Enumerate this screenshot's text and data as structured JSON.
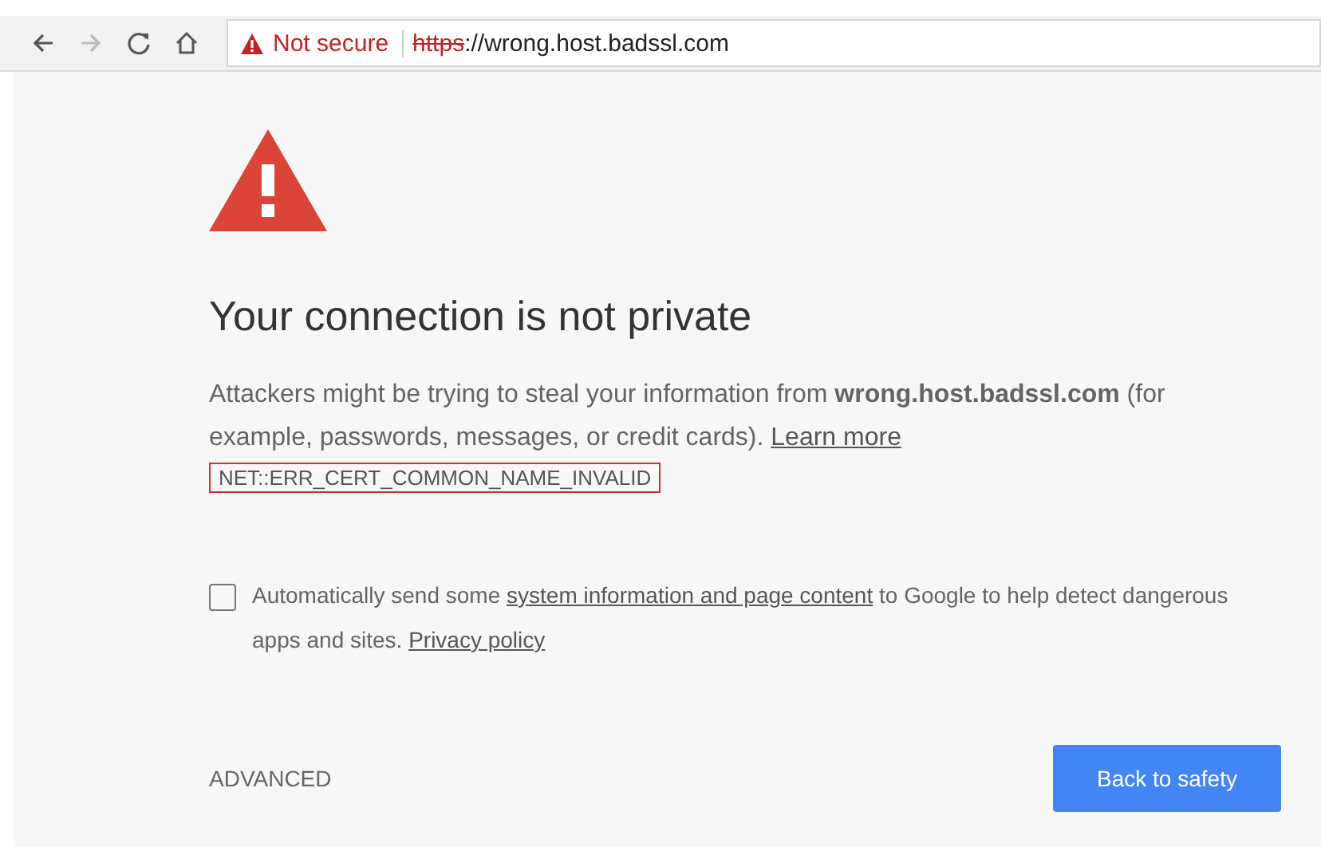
{
  "toolbar": {
    "security_label": "Not secure",
    "url_scheme": "https",
    "url_rest": "://wrong.host.badssl.com"
  },
  "page": {
    "title": "Your connection is not private",
    "message": "Attackers might be trying to steal your information from **wrong.host.badssl.com** (for example, passwords, messages, or credit cards).",
    "learn_more": "Learn more",
    "error_code": "NET::ERR_CERT_COMMON_NAME_INVALID",
    "report": {
      "checked": false,
      "before": "Automatically send some",
      "link": "system information and page content",
      "after": "to Google to help detect dangerous apps and sites.",
      "policy": "Privacy policy"
    },
    "advanced": "ADVANCED",
    "back_button": "Back to safety"
  }
}
